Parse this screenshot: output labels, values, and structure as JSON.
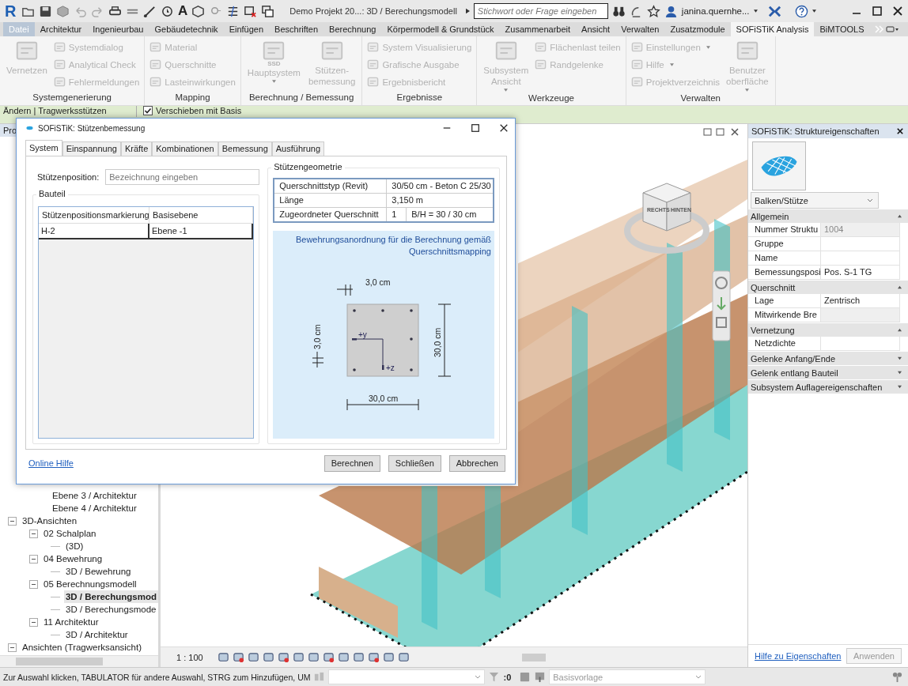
{
  "app": {
    "logo": "R",
    "text_tool": "A",
    "title": "Demo Projekt 20...: 3D / Berechungsmodell",
    "search": {
      "placeholder": "Stichwort oder Frage eingeben"
    },
    "user": "janina.quernhe..."
  },
  "ribbon_tabs": [
    {
      "label": "Datei",
      "kind": "file",
      "selected": false
    },
    {
      "label": "Architektur",
      "kind": "tab",
      "selected": false
    },
    {
      "label": "Ingenieurbau",
      "kind": "tab",
      "selected": false
    },
    {
      "label": "Gebäudetechnik",
      "kind": "tab",
      "selected": false
    },
    {
      "label": "Einfügen",
      "kind": "tab",
      "selected": false
    },
    {
      "label": "Beschriften",
      "kind": "tab",
      "selected": false
    },
    {
      "label": "Berechnung",
      "kind": "tab",
      "selected": false
    },
    {
      "label": "Körpermodell & Grundstück",
      "kind": "tab",
      "selected": false
    },
    {
      "label": "Zusammenarbeit",
      "kind": "tab",
      "selected": false
    },
    {
      "label": "Ansicht",
      "kind": "tab",
      "selected": false
    },
    {
      "label": "Verwalten",
      "kind": "tab",
      "selected": false
    },
    {
      "label": "Zusatzmodule",
      "kind": "tab",
      "selected": false
    },
    {
      "label": "SOFiSTiK Analysis",
      "kind": "tab",
      "selected": true
    },
    {
      "label": "BiMTOOLS",
      "kind": "tab",
      "selected": false
    }
  ],
  "ribbon_groups": [
    {
      "title": "Systemgenerierung",
      "items": [
        {
          "kind": "large",
          "lines": [
            "Vernetzen"
          ],
          "disabled": true
        },
        {
          "kind": "small",
          "label": "Systemdialog",
          "disabled": true
        },
        {
          "kind": "small",
          "label": "Analytical Check",
          "disabled": true
        },
        {
          "kind": "small",
          "label": "Fehlermeldungen",
          "disabled": true
        }
      ]
    },
    {
      "title": "Mapping",
      "items": [
        {
          "kind": "small",
          "label": "Material",
          "disabled": true
        },
        {
          "kind": "small",
          "label": "Querschnitte",
          "disabled": true
        },
        {
          "kind": "small",
          "label": "Lasteinwirkungen",
          "disabled": true
        }
      ]
    },
    {
      "title": "Berechnung / Bemessung",
      "items": [
        {
          "kind": "large",
          "lines": [
            "Hauptsystem"
          ],
          "icon_text": "SSD",
          "dropdown": true,
          "disabled": true
        },
        {
          "kind": "large",
          "lines": [
            "Stützen-",
            "bemessung"
          ],
          "disabled": true
        }
      ]
    },
    {
      "title": "Ergebnisse",
      "items": [
        {
          "kind": "small",
          "label": "System Visualisierung",
          "disabled": true
        },
        {
          "kind": "small",
          "label": "Grafische Ausgabe",
          "disabled": true
        },
        {
          "kind": "small",
          "label": "Ergebnisbericht",
          "disabled": true
        }
      ]
    },
    {
      "title": "Werkzeuge",
      "items": [
        {
          "kind": "large",
          "lines": [
            "Subsystem",
            "Ansicht"
          ],
          "dropdown": true,
          "disabled": true
        },
        {
          "kind": "small",
          "label": "Flächenlast teilen",
          "disabled": true
        },
        {
          "kind": "small",
          "label": "Randgelenke",
          "disabled": true
        }
      ]
    },
    {
      "title": "Verwalten",
      "items": [
        {
          "kind": "small",
          "label": "Einstellungen",
          "dropdown": true,
          "disabled": true
        },
        {
          "kind": "small",
          "label": "Hilfe",
          "dropdown": true,
          "disabled": true
        },
        {
          "kind": "small",
          "label": "Projektverzeichnis",
          "disabled": true
        },
        {
          "kind": "large",
          "lines": [
            "Benutzer",
            "oberfläche"
          ],
          "dropdown": true,
          "disabled": true
        }
      ]
    }
  ],
  "options_bar": {
    "context": "Ändern | Tragwerksstützen",
    "checkbox": {
      "label": "Verschieben mit Basis",
      "checked": true
    }
  },
  "project_browser": {
    "header": "Pro",
    "leading_items": [
      {
        "label": "Ebene 3 / Architektur",
        "selected": false
      },
      {
        "label": "Ebene 4 / Architektur",
        "selected": false
      }
    ],
    "tree": [
      {
        "label": "3D-Ansichten",
        "expanded": true,
        "selected": false,
        "children": [
          {
            "label": "02 Schalplan",
            "expanded": true,
            "selected": false,
            "children": [
              {
                "label": "(3D)",
                "selected": false
              }
            ]
          },
          {
            "label": "04 Bewehrung",
            "expanded": true,
            "selected": false,
            "children": [
              {
                "label": "3D / Bewehrung",
                "selected": false
              }
            ]
          },
          {
            "label": "05 Berechnungsmodell",
            "expanded": true,
            "selected": false,
            "children": [
              {
                "label": "3D / Berechungsmod",
                "selected": true
              },
              {
                "label": "3D / Berechungsmode",
                "selected": false
              }
            ]
          },
          {
            "label": "11 Architektur",
            "expanded": true,
            "selected": false,
            "children": [
              {
                "label": "3D / Architektur",
                "selected": false
              }
            ]
          }
        ]
      },
      {
        "label": "Ansichten (Tragwerksansicht)",
        "expanded": true,
        "selected": false
      }
    ]
  },
  "view": {
    "scale": "1 : 100",
    "viewcube_labels": [
      "RECHTS",
      "HINTEN"
    ]
  },
  "dialog": {
    "title": "SOFiSTiK: Stützenbemessung",
    "tabs": [
      {
        "label": "System",
        "selected": true
      },
      {
        "label": "Einspannung",
        "selected": false
      },
      {
        "label": "Kräfte",
        "selected": false
      },
      {
        "label": "Kombinationen",
        "selected": false
      },
      {
        "label": "Bemessung",
        "selected": false
      },
      {
        "label": "Ausführung",
        "selected": false
      }
    ],
    "position_label": "Stützenposition:",
    "position_field": {
      "placeholder": "Bezeichnung eingeben"
    },
    "component_group": {
      "title": "Bauteil",
      "columns": [
        "Stützenpositionsmarkierung",
        "Basisebene"
      ],
      "rows": [
        [
          "H-2",
          "Ebene -1"
        ]
      ]
    },
    "geometry_group": {
      "title": "Stützengeometrie",
      "rows": [
        {
          "label": "Querschnittstyp (Revit)",
          "values": [
            "30/50 cm - Beton C 25/30"
          ]
        },
        {
          "label": "Länge",
          "values": [
            "3,150 m"
          ]
        },
        {
          "label": "Zugeordneter Querschnitt",
          "values": [
            "1",
            "B/H = 30 / 30 cm"
          ]
        }
      ]
    },
    "reinforcement": {
      "caption": "Bewehrungsanordnung für die Berechnung gemäß Querschnittsmapping",
      "cover_top": "3,0 cm",
      "cover_left": "3,0 cm",
      "height": "30,0 cm",
      "width": "30,0 cm",
      "axis_y": "+y",
      "axis_z": "+z"
    },
    "help_link": "Online Hilfe",
    "buttons": [
      "Berechnen",
      "Schließen",
      "Abbrechen"
    ]
  },
  "properties": {
    "title": "SOFiSTiK: Struktureigenschaften",
    "type": "Balken/Stütze",
    "sections": [
      {
        "title": "Allgemein",
        "expanded": true,
        "rows": [
          {
            "label": "Nummer Struktu",
            "value": "1004",
            "readonly": true
          },
          {
            "label": "Gruppe",
            "readonly": false
          },
          {
            "label": "Name",
            "readonly": false
          },
          {
            "label": "Bemessungsposi",
            "value": "Pos. S-1 TG",
            "readonly": false
          }
        ]
      },
      {
        "title": "Querschnitt",
        "expanded": true,
        "rows": [
          {
            "label": "Lage",
            "value": "Zentrisch",
            "readonly": false
          },
          {
            "label": "Mitwirkende Bre",
            "readonly": true
          }
        ]
      },
      {
        "title": "Vernetzung",
        "expanded": true,
        "rows": [
          {
            "label": "Netzdichte",
            "readonly": false
          }
        ]
      },
      {
        "title": "Gelenke Anfang/Ende",
        "expanded": false
      },
      {
        "title": "Gelenk entlang Bauteil",
        "expanded": false
      },
      {
        "title": "Subsystem Auflagereigenschaften",
        "expanded": false
      }
    ],
    "help_link": "Hilfe zu Eigenschaften",
    "apply_button": {
      "label": "Anwenden",
      "disabled": true
    }
  },
  "status": {
    "hint": "Zur Auswahl klicken, TABULATOR für andere Auswahl, STRG zum Hinzufügen, UM",
    "filter_count": ":0",
    "template": "Basisvorlage"
  }
}
